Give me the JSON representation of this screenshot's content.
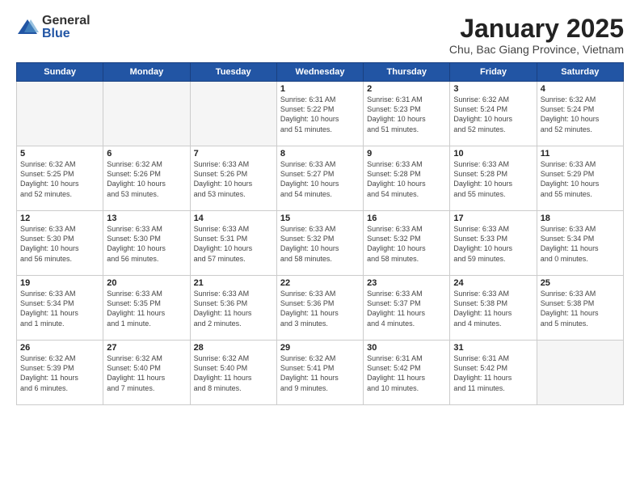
{
  "logo": {
    "general": "General",
    "blue": "Blue"
  },
  "title": "January 2025",
  "subtitle": "Chu, Bac Giang Province, Vietnam",
  "weekdays": [
    "Sunday",
    "Monday",
    "Tuesday",
    "Wednesday",
    "Thursday",
    "Friday",
    "Saturday"
  ],
  "weeks": [
    [
      {
        "day": "",
        "info": ""
      },
      {
        "day": "",
        "info": ""
      },
      {
        "day": "",
        "info": ""
      },
      {
        "day": "1",
        "info": "Sunrise: 6:31 AM\nSunset: 5:22 PM\nDaylight: 10 hours\nand 51 minutes."
      },
      {
        "day": "2",
        "info": "Sunrise: 6:31 AM\nSunset: 5:23 PM\nDaylight: 10 hours\nand 51 minutes."
      },
      {
        "day": "3",
        "info": "Sunrise: 6:32 AM\nSunset: 5:24 PM\nDaylight: 10 hours\nand 52 minutes."
      },
      {
        "day": "4",
        "info": "Sunrise: 6:32 AM\nSunset: 5:24 PM\nDaylight: 10 hours\nand 52 minutes."
      }
    ],
    [
      {
        "day": "5",
        "info": "Sunrise: 6:32 AM\nSunset: 5:25 PM\nDaylight: 10 hours\nand 52 minutes."
      },
      {
        "day": "6",
        "info": "Sunrise: 6:32 AM\nSunset: 5:26 PM\nDaylight: 10 hours\nand 53 minutes."
      },
      {
        "day": "7",
        "info": "Sunrise: 6:33 AM\nSunset: 5:26 PM\nDaylight: 10 hours\nand 53 minutes."
      },
      {
        "day": "8",
        "info": "Sunrise: 6:33 AM\nSunset: 5:27 PM\nDaylight: 10 hours\nand 54 minutes."
      },
      {
        "day": "9",
        "info": "Sunrise: 6:33 AM\nSunset: 5:28 PM\nDaylight: 10 hours\nand 54 minutes."
      },
      {
        "day": "10",
        "info": "Sunrise: 6:33 AM\nSunset: 5:28 PM\nDaylight: 10 hours\nand 55 minutes."
      },
      {
        "day": "11",
        "info": "Sunrise: 6:33 AM\nSunset: 5:29 PM\nDaylight: 10 hours\nand 55 minutes."
      }
    ],
    [
      {
        "day": "12",
        "info": "Sunrise: 6:33 AM\nSunset: 5:30 PM\nDaylight: 10 hours\nand 56 minutes."
      },
      {
        "day": "13",
        "info": "Sunrise: 6:33 AM\nSunset: 5:30 PM\nDaylight: 10 hours\nand 56 minutes."
      },
      {
        "day": "14",
        "info": "Sunrise: 6:33 AM\nSunset: 5:31 PM\nDaylight: 10 hours\nand 57 minutes."
      },
      {
        "day": "15",
        "info": "Sunrise: 6:33 AM\nSunset: 5:32 PM\nDaylight: 10 hours\nand 58 minutes."
      },
      {
        "day": "16",
        "info": "Sunrise: 6:33 AM\nSunset: 5:32 PM\nDaylight: 10 hours\nand 58 minutes."
      },
      {
        "day": "17",
        "info": "Sunrise: 6:33 AM\nSunset: 5:33 PM\nDaylight: 10 hours\nand 59 minutes."
      },
      {
        "day": "18",
        "info": "Sunrise: 6:33 AM\nSunset: 5:34 PM\nDaylight: 11 hours\nand 0 minutes."
      }
    ],
    [
      {
        "day": "19",
        "info": "Sunrise: 6:33 AM\nSunset: 5:34 PM\nDaylight: 11 hours\nand 1 minute."
      },
      {
        "day": "20",
        "info": "Sunrise: 6:33 AM\nSunset: 5:35 PM\nDaylight: 11 hours\nand 1 minute."
      },
      {
        "day": "21",
        "info": "Sunrise: 6:33 AM\nSunset: 5:36 PM\nDaylight: 11 hours\nand 2 minutes."
      },
      {
        "day": "22",
        "info": "Sunrise: 6:33 AM\nSunset: 5:36 PM\nDaylight: 11 hours\nand 3 minutes."
      },
      {
        "day": "23",
        "info": "Sunrise: 6:33 AM\nSunset: 5:37 PM\nDaylight: 11 hours\nand 4 minutes."
      },
      {
        "day": "24",
        "info": "Sunrise: 6:33 AM\nSunset: 5:38 PM\nDaylight: 11 hours\nand 4 minutes."
      },
      {
        "day": "25",
        "info": "Sunrise: 6:33 AM\nSunset: 5:38 PM\nDaylight: 11 hours\nand 5 minutes."
      }
    ],
    [
      {
        "day": "26",
        "info": "Sunrise: 6:32 AM\nSunset: 5:39 PM\nDaylight: 11 hours\nand 6 minutes."
      },
      {
        "day": "27",
        "info": "Sunrise: 6:32 AM\nSunset: 5:40 PM\nDaylight: 11 hours\nand 7 minutes."
      },
      {
        "day": "28",
        "info": "Sunrise: 6:32 AM\nSunset: 5:40 PM\nDaylight: 11 hours\nand 8 minutes."
      },
      {
        "day": "29",
        "info": "Sunrise: 6:32 AM\nSunset: 5:41 PM\nDaylight: 11 hours\nand 9 minutes."
      },
      {
        "day": "30",
        "info": "Sunrise: 6:31 AM\nSunset: 5:42 PM\nDaylight: 11 hours\nand 10 minutes."
      },
      {
        "day": "31",
        "info": "Sunrise: 6:31 AM\nSunset: 5:42 PM\nDaylight: 11 hours\nand 11 minutes."
      },
      {
        "day": "",
        "info": ""
      }
    ]
  ]
}
